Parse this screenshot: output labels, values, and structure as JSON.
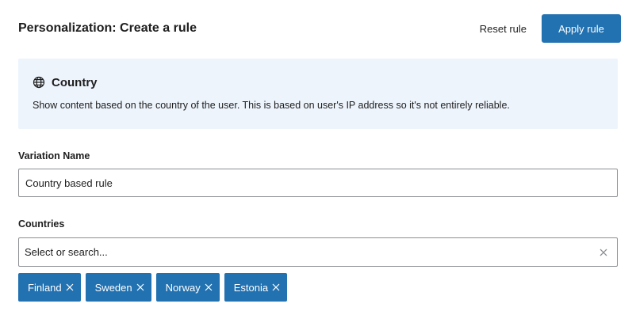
{
  "header": {
    "title": "Personalization: Create a rule",
    "reset_label": "Reset rule",
    "apply_label": "Apply rule"
  },
  "info": {
    "icon": "globe-icon",
    "title": "Country",
    "description": "Show content based on the country of the user. This is based on user's IP address so it's not entirely reliable."
  },
  "variation": {
    "label": "Variation Name",
    "value": "Country based rule"
  },
  "countries": {
    "label": "Countries",
    "placeholder": "Select or search...",
    "selected": [
      "Finland",
      "Sweden",
      "Norway",
      "Estonia"
    ]
  },
  "colors": {
    "accent": "#2271b1",
    "info_bg": "#edf4fc",
    "border": "#8c8f94"
  }
}
